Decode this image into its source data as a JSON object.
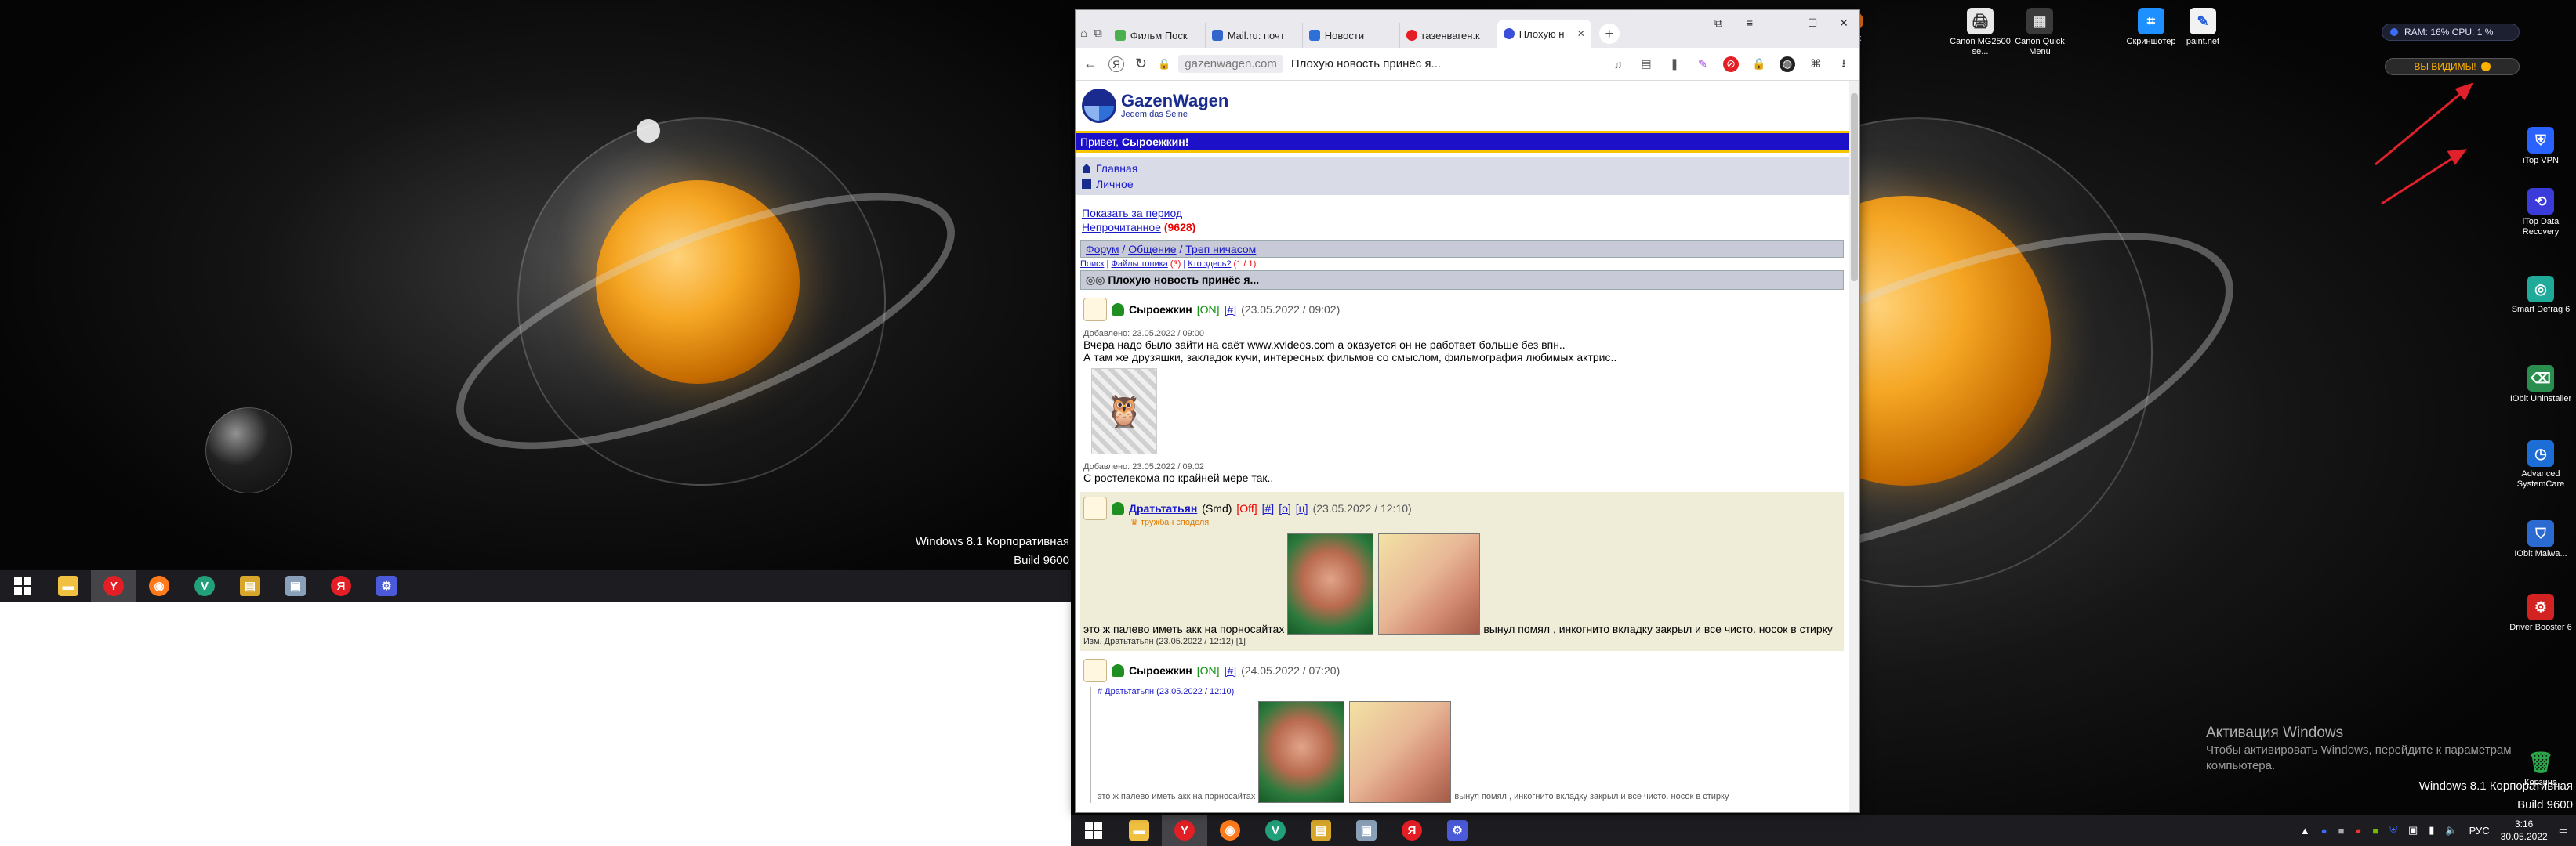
{
  "desktop": {
    "windows_version_line1": "Windows 8.1 Корпоративная",
    "windows_version_line2": "Build 9600",
    "activation_title": "Активация Windows",
    "activation_text": "Чтобы активировать Windows, перейдите к параметрам компьютера.",
    "ram_cpu": "RAM: 16%   CPU: 1 %",
    "visible_label": "ВЫ ВИДИМЫ!",
    "top_partial_icon": "efox",
    "icons": [
      {
        "label": "Canon MG2500 se...",
        "color": "#e8e8e8",
        "glyph": "🖨"
      },
      {
        "label": "Canon Quick Menu",
        "color": "#3a3a3a",
        "glyph": "▦"
      },
      {
        "label": "Скриншотер",
        "color": "#1e90ff",
        "glyph": "⌗"
      },
      {
        "label": "paint.net",
        "color": "#f2f2f2",
        "glyph": "✎"
      },
      {
        "label": "iTop VPN",
        "color": "#2962ff",
        "glyph": "⛨"
      },
      {
        "label": "iTop Data Recovery",
        "color": "#3b3bd9",
        "glyph": "⟲"
      },
      {
        "label": "Smart Defrag 6",
        "color": "#1faa9a",
        "glyph": "◎"
      },
      {
        "label": "IObit Uninstaller",
        "color": "#2a8f4e",
        "glyph": "⌫"
      },
      {
        "label": "Advanced SystemCare",
        "color": "#1c6dd6",
        "glyph": "◷"
      },
      {
        "label": "IObit Malwa...",
        "color": "#2b6ad0",
        "glyph": "⛉"
      },
      {
        "label": "Driver Booster 6",
        "color": "#d32222",
        "glyph": "⚙"
      },
      {
        "label": "Корзина",
        "color": "#2aa84a",
        "glyph": "🗑"
      }
    ]
  },
  "taskbar": {
    "apps": [
      {
        "name": "explorer",
        "glyph": "📁",
        "color": "#f0c040"
      },
      {
        "name": "yandex-browser",
        "glyph": "Y",
        "color": "#e31e24"
      },
      {
        "name": "firefox",
        "glyph": "◉",
        "color": "#ff7a1a"
      },
      {
        "name": "vpn-app",
        "glyph": "V",
        "color": "#22a07a"
      },
      {
        "name": "archive",
        "glyph": "▤",
        "color": "#d7a62a"
      },
      {
        "name": "remote",
        "glyph": "▣",
        "color": "#8aa0b8"
      },
      {
        "name": "yandex",
        "glyph": "Я",
        "color": "#e31e24"
      },
      {
        "name": "system-tool",
        "glyph": "⚙",
        "color": "#4a5ad8"
      }
    ],
    "lang": "РУС",
    "time": "3:16",
    "date": "30.05.2022"
  },
  "browser": {
    "tabs": [
      {
        "label": "Фильм Поск",
        "color": "#4caf50"
      },
      {
        "label": "Mail.ru: почт",
        "color": "#3366cc"
      },
      {
        "label": "Новости",
        "color": "#2f6fd8"
      },
      {
        "label": "газенваген.к",
        "color": "#e31e24"
      },
      {
        "label": "Плохую н",
        "color": "#3b4fd8"
      }
    ],
    "host": "gazenwagen.com",
    "page_title": "Плохую новость принёс я...",
    "site": {
      "logo_name": "GazenWagen",
      "logo_slogan": "Jedem das Seine",
      "greeting": "Привет,",
      "greeting_user": "Сыроежкин!",
      "menu": [
        "Главная",
        "Личное"
      ],
      "show_period": "Показать за период",
      "unread_label": "Непрочитанное",
      "unread_open": "(",
      "unread_count": "9628",
      "unread_close": ")",
      "crumbs": [
        "Форум",
        "Общение",
        "Треп ничасом"
      ],
      "crumb_sep": "/",
      "subcrumbs": [
        "Поиск",
        "Файлы топика",
        "Кто здесь?"
      ],
      "subcrumb_badge": "(3)",
      "subcrumb_count": "(1 / 1)",
      "thread_title": "Плохую новость принёс я..."
    },
    "posts": [
      {
        "user": "Сыроежкин",
        "status": "[ON]",
        "hash": "[#]",
        "date": "(23.05.2022 / 09:02)",
        "added1": "Добавлено: 23.05.2022 / 09:00",
        "text1": "Вчера надо было зайти на саёт www.xvideos.com а оказуется он не работает больше без впн..",
        "text2": "А там же друзяшки, закладок кучи, интересных фильмов со смыслом, фильмография любимых актрис..",
        "added2": "Добавлено: 23.05.2022 / 09:02",
        "text3": "С ростелекома по крайней мере так.."
      },
      {
        "user": "Дратьтатьян",
        "role": "(Smd)",
        "status": "[Off]",
        "hash": "[#]",
        "o": "[о]",
        "u": "[ц]",
        "date": "(23.05.2022 / 12:10)",
        "rank": "тружбан споделя",
        "text_before": "это ж палево иметь акк на порносайтах",
        "text_after": "вынул помял , инкогнито вкладку закрыл и все чисто. носок в стирку",
        "edited": "Изм. Дратьтатьян (23.05.2022 / 12:12) [1]"
      },
      {
        "user": "Сыроежкин",
        "status": "[ON]",
        "hash": "[#]",
        "date": "(24.05.2022 / 07:20)",
        "quote_head": "# Дратьтатьян (23.05.2022 / 12:10)",
        "quote_before": "это ж палево иметь акк на порносайтах",
        "quote_after": "вынул помял , инкогнито вкладку закрыл и все чисто. носок в стирку"
      }
    ]
  }
}
